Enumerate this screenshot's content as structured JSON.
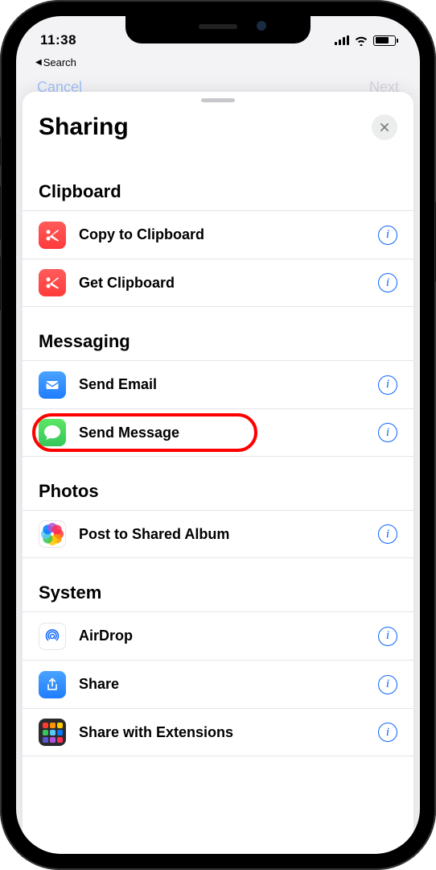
{
  "status": {
    "time": "11:38",
    "back_label": "Search"
  },
  "behind": {
    "left": "Cancel",
    "right": "Next"
  },
  "sheet": {
    "title": "Sharing",
    "sections": [
      {
        "title": "Clipboard",
        "items": [
          {
            "label": "Copy to Clipboard",
            "icon": "scissors-icon"
          },
          {
            "label": "Get Clipboard",
            "icon": "scissors-icon"
          }
        ]
      },
      {
        "title": "Messaging",
        "items": [
          {
            "label": "Send Email",
            "icon": "mail-icon"
          },
          {
            "label": "Send Message",
            "icon": "message-icon",
            "highlighted": true
          }
        ]
      },
      {
        "title": "Photos",
        "items": [
          {
            "label": "Post to Shared Album",
            "icon": "photos-icon"
          }
        ]
      },
      {
        "title": "System",
        "items": [
          {
            "label": "AirDrop",
            "icon": "airdrop-icon"
          },
          {
            "label": "Share",
            "icon": "share-icon"
          },
          {
            "label": "Share with Extensions",
            "icon": "extensions-icon"
          }
        ]
      }
    ]
  }
}
